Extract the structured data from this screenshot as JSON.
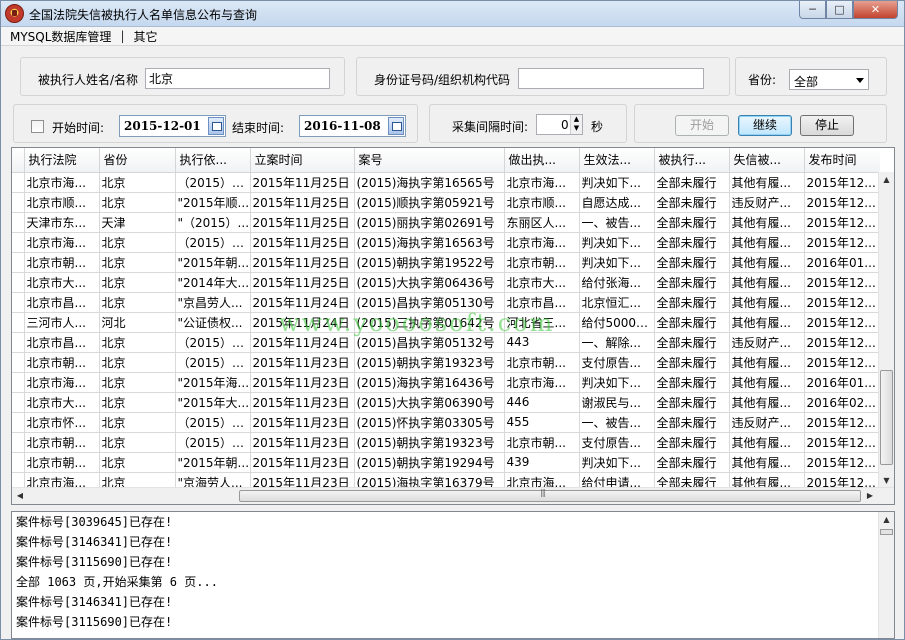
{
  "window": {
    "title": "全国法院失信被执行人名单信息公布与查询",
    "minimize_glyph": "─",
    "maximize_glyph": "□",
    "close_glyph": "✕"
  },
  "menu": {
    "items": [
      "MYSQL数据库管理",
      "其它"
    ],
    "separator": "|"
  },
  "search": {
    "name_label": "被执行人姓名/名称",
    "name_value": "北京",
    "id_label": "身份证号码/组织机构代码",
    "id_value": "",
    "province_label": "省份:",
    "province_value": "全部"
  },
  "time": {
    "start_checkbox_label": "开始时间:",
    "start_checked": false,
    "start_date": "2015-12-01",
    "end_label": "结束时间:",
    "end_date": "2016-11-08",
    "interval_label": "采集间隔时间:",
    "interval_value": "0",
    "interval_unit": "秒"
  },
  "buttons": {
    "start": "开始",
    "continue": "继续",
    "stop": "停止"
  },
  "table": {
    "columns": [
      "执行法院",
      "省份",
      "执行依...",
      "立案时间",
      "案号",
      "做出执...",
      "生效法...",
      "被执行...",
      "失信被...",
      "发布时间"
    ],
    "rows": [
      [
        "北京市海...",
        "北京",
        "（2015）海...",
        "2015年11月25日",
        "(2015)海执字第16565号",
        "北京市海...",
        "判决如下...",
        "全部未履行",
        "其他有履...",
        "2015年12..."
      ],
      [
        "北京市顺...",
        "北京",
        "\"2015年顺...",
        "2015年11月25日",
        "(2015)顺执字第05921号",
        "北京市顺...",
        "自愿达成...",
        "全部未履行",
        "违反财产...",
        "2015年12..."
      ],
      [
        "天津市东...",
        "天津",
        "\"（2015）...",
        "2015年11月25日",
        "(2015)丽执字第02691号",
        "东丽区人...",
        "一、被告...",
        "全部未履行",
        "其他有履...",
        "2015年12..."
      ],
      [
        "北京市海...",
        "北京",
        "（2015）海...",
        "2015年11月25日",
        "(2015)海执字第16563号",
        "北京市海...",
        "判决如下...",
        "全部未履行",
        "其他有履...",
        "2015年12..."
      ],
      [
        "北京市朝...",
        "北京",
        "\"2015年朝...",
        "2015年11月25日",
        "(2015)朝执字第19522号",
        "北京市朝...",
        "判决如下...",
        "全部未履行",
        "其他有履...",
        "2016年01..."
      ],
      [
        "北京市大...",
        "北京",
        "\"2014年大...",
        "2015年11月25日",
        "(2015)大执字第06436号",
        "北京市大...",
        "给付张海...",
        "全部未履行",
        "其他有履...",
        "2015年12..."
      ],
      [
        "北京市昌...",
        "北京",
        "\"京昌劳人...",
        "2015年11月24日",
        "(2015)昌执字第05130号",
        "北京市昌...",
        "北京恒汇...",
        "全部未履行",
        "其他有履...",
        "2015年12..."
      ],
      [
        "三河市人...",
        "河北",
        "\"公证债权...",
        "2015年11月24日",
        "(2015)三执字第01642号",
        "河北省三...",
        "给付50000...",
        "全部未履行",
        "其他有履...",
        "2015年12..."
      ],
      [
        "北京市昌...",
        "北京",
        "（2015）昌...",
        "2015年11月24日",
        "(2015)昌执字第05132号",
        "443",
        "一、解除...",
        "全部未履行",
        "违反财产...",
        "2015年12..."
      ],
      [
        "北京市朝...",
        "北京",
        "（2015）朝...",
        "2015年11月23日",
        "(2015)朝执字第19323号",
        "北京市朝...",
        "支付原告...",
        "全部未履行",
        "其他有履...",
        "2015年12..."
      ],
      [
        "北京市海...",
        "北京",
        "\"2015年海...",
        "2015年11月23日",
        "(2015)海执字第16436号",
        "北京市海...",
        "判决如下...",
        "全部未履行",
        "其他有履...",
        "2016年01..."
      ],
      [
        "北京市大...",
        "北京",
        "\"2015年大...",
        "2015年11月23日",
        "(2015)大执字第06390号",
        "446",
        "谢淑民与...",
        "全部未履行",
        "其他有履...",
        "2016年02..."
      ],
      [
        "北京市怀...",
        "北京",
        "（2015）怀...",
        "2015年11月23日",
        "(2015)怀执字第03305号",
        "455",
        "一、被告...",
        "全部未履行",
        "违反财产...",
        "2015年12..."
      ],
      [
        "北京市朝...",
        "北京",
        "（2015）朝...",
        "2015年11月23日",
        "(2015)朝执字第19323号",
        "北京市朝...",
        "支付原告...",
        "全部未履行",
        "其他有履...",
        "2015年12..."
      ],
      [
        "北京市朝...",
        "北京",
        "\"2015年朝...",
        "2015年11月23日",
        "(2015)朝执字第19294号",
        "439",
        "判决如下...",
        "全部未履行",
        "其他有履...",
        "2015年12..."
      ],
      [
        "北京市海...",
        "北京",
        "\"京海劳人...",
        "2015年11月23日",
        "(2015)海执字第16379号",
        "北京市海...",
        "给付申请...",
        "全部未履行",
        "其他有履...",
        "2015年12..."
      ]
    ]
  },
  "watermark": "www.yoooosoft.com",
  "log": {
    "lines": [
      "案件标号[3039645]已存在!",
      "案件标号[3146341]已存在!",
      "案件标号[3115690]已存在!",
      "全部 1063 页,开始采集第 6 页...",
      "案件标号[3146341]已存在!",
      "案件标号[3115690]已存在!"
    ]
  }
}
